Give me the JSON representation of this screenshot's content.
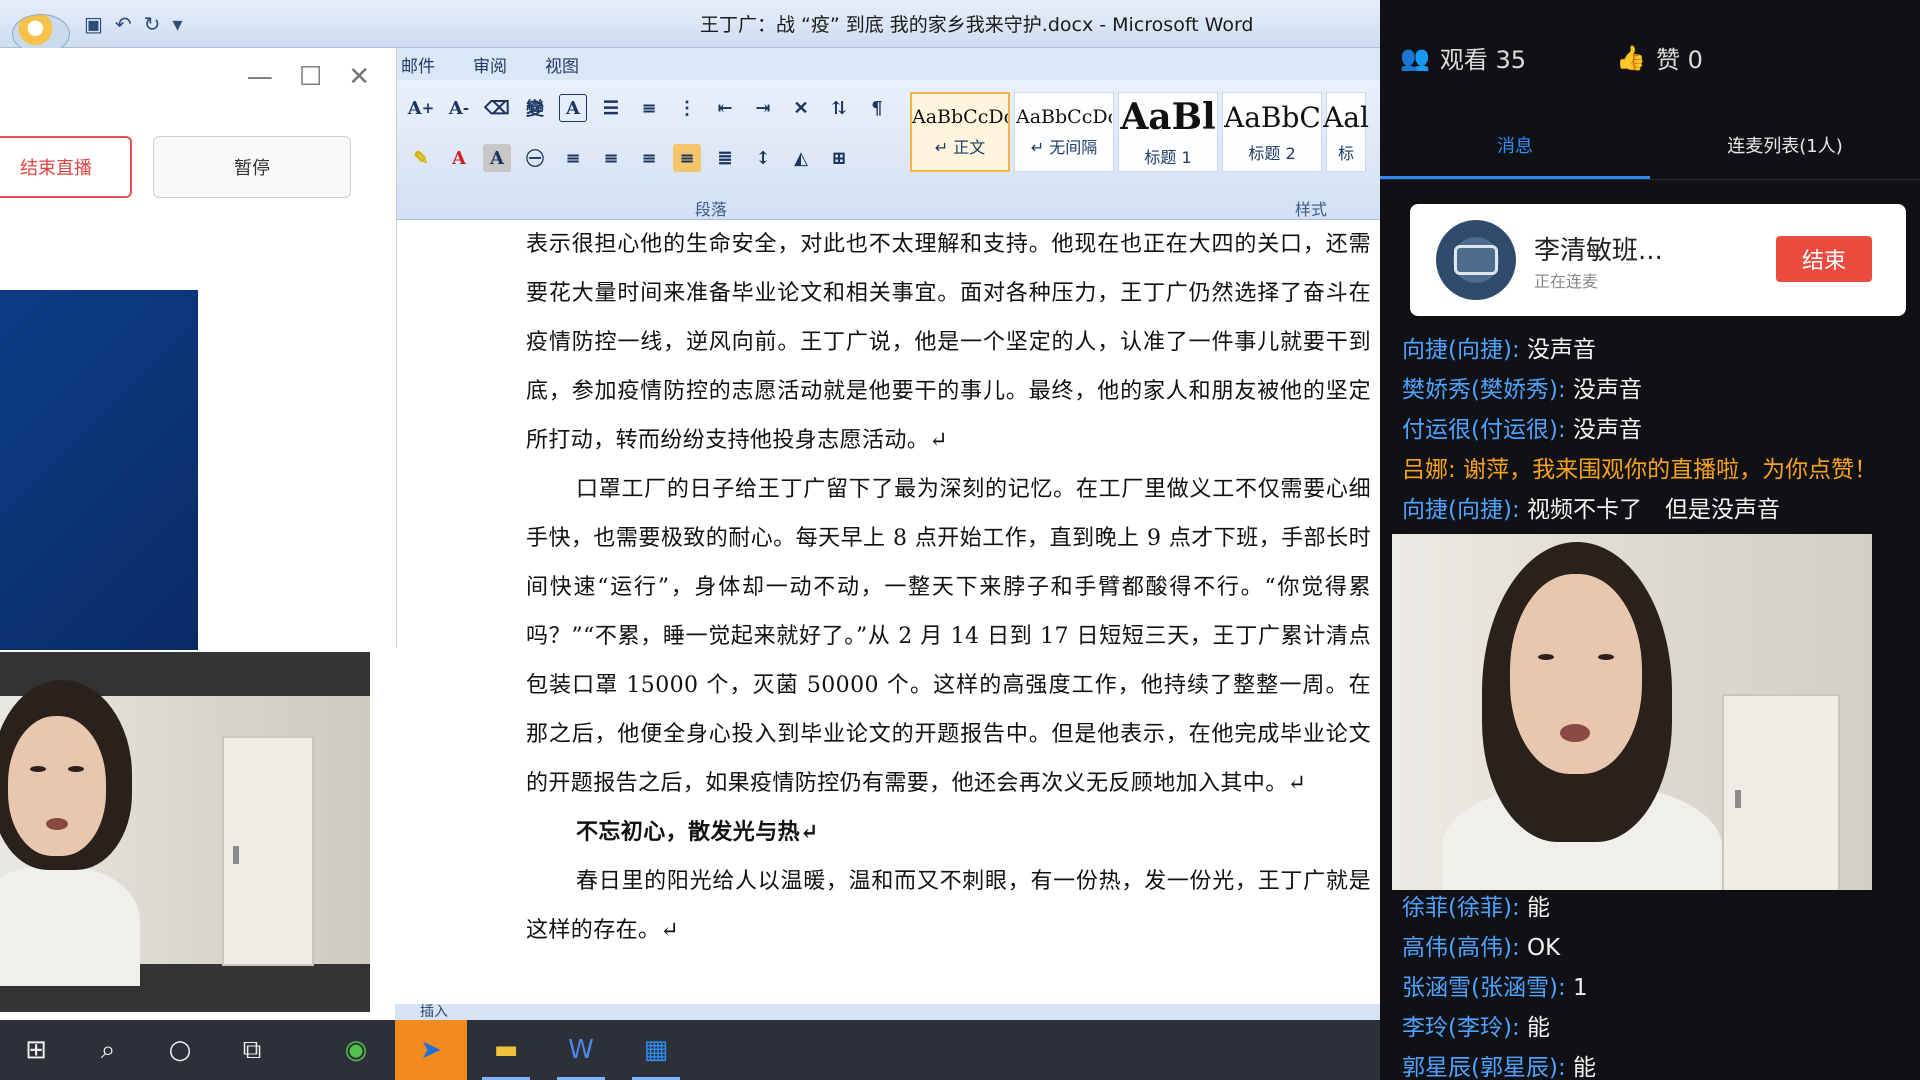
{
  "word": {
    "title": "王丁广：战 “疫” 到底 我的家乡我来守护.docx - Microsoft Word",
    "tabs": [
      "邮件",
      "审阅",
      "视图"
    ],
    "groups": {
      "paragraph": "段落",
      "styles": "样式"
    },
    "style_gallery": [
      {
        "sample": "AaBbCcDc",
        "name": "↵ 正文",
        "active": true
      },
      {
        "sample": "AaBbCcDc",
        "name": "↵ 无间隔",
        "active": false
      },
      {
        "sample": "AaBl",
        "name": "标题 1",
        "active": false
      },
      {
        "sample": "AaBbC",
        "name": "标题 2",
        "active": false
      },
      {
        "sample": "Aal",
        "name": "标",
        "active": false
      }
    ],
    "status_label": "插入",
    "paragraphs": [
      {
        "type": "cont",
        "text": "表示很担心他的生命安全，对此也不太理解和支持。他现在也正在大四的关口，还需要花大量时间来准备毕业论文和相关事宜。面对各种压力，王丁广仍然选择了奋斗在疫情防控一线，逆风向前。王丁广说，他是一个坚定的人，认准了一件事儿就要干到底，参加疫情防控的志愿活动就是他要干的事儿。最终，他的家人和朋友被他的坚定所打动，转而纷纷支持他投身志愿活动。↵"
      },
      {
        "type": "indent",
        "text": "口罩工厂的日子给王丁广留下了最为深刻的记忆。在工厂里做义工不仅需要心细手快，也需要极致的耐心。每天早上 8 点开始工作，直到晚上 9 点才下班，手部长时间快速“运行”，身体却一动不动，一整天下来脖子和手臂都酸得不行。“你觉得累吗？”“不累，睡一觉起来就好了。”从 2 月 14 日到 17 日短短三天，王丁广累计清点包装口罩 15000 个，灭菌 50000 个。这样的高强度工作，他持续了整整一周。在那之后，他便全身心投入到毕业论文的开题报告中。但是他表示，在他完成毕业论文的开题报告之后，如果疫情防控仍有需要，他还会再次义无反顾地加入其中。↵"
      },
      {
        "type": "heading",
        "text": "不忘初心，散发光与热↵"
      },
      {
        "type": "indent",
        "text": "春日里的阳光给人以温暖，温和而又不刺眼，有一份热，发一份光，王丁广就是这样的存在。↵"
      }
    ]
  },
  "live_control": {
    "end_live_label": "结束直播",
    "pause_label": "暂停"
  },
  "taskbar": {
    "items": [
      "start-icon",
      "search-icon",
      "cortana-icon",
      "task-view-icon",
      "browser-icon",
      "feishu-icon",
      "file-explorer-icon",
      "word-icon",
      "calendar-app-icon"
    ]
  },
  "live_panel": {
    "viewers_label": "观看 35",
    "likes_label": "赞 0",
    "tabs": [
      "消息",
      "连麦列表(1人)"
    ],
    "connect": {
      "name": "李清敏班...",
      "status": "正在连麦",
      "end_label": "结束"
    },
    "messages_top": [
      {
        "name": "向捷(向捷):",
        "text": "没声音",
        "highlight": false
      },
      {
        "name": "樊娇秀(樊娇秀):",
        "text": "没声音",
        "highlight": false
      },
      {
        "name": "付运很(付运很):",
        "text": "没声音",
        "highlight": false
      },
      {
        "name": "吕娜:",
        "text": "谢萍，我来围观你的直播啦，为你点赞！",
        "highlight": true
      },
      {
        "name": "向捷(向捷):",
        "text": "视频不卡了　但是没声音",
        "highlight": false
      }
    ],
    "messages_bottom": [
      {
        "name": "徐菲(徐菲):",
        "text": "能",
        "highlight": false
      },
      {
        "name": "高伟(高伟):",
        "text": "OK",
        "highlight": false
      },
      {
        "name": "张涵雪(张涵雪):",
        "text": "1",
        "highlight": false
      },
      {
        "name": "李玲(李玲):",
        "text": "能",
        "highlight": false
      },
      {
        "name": "郭星辰(郭星辰):",
        "text": "能",
        "highlight": false
      }
    ]
  },
  "colors": {
    "accent_blue": "#2f8cf3",
    "end_red": "#ec4b3f",
    "highlight_orange": "#f7a21b",
    "name_blue": "#4da3ff"
  }
}
